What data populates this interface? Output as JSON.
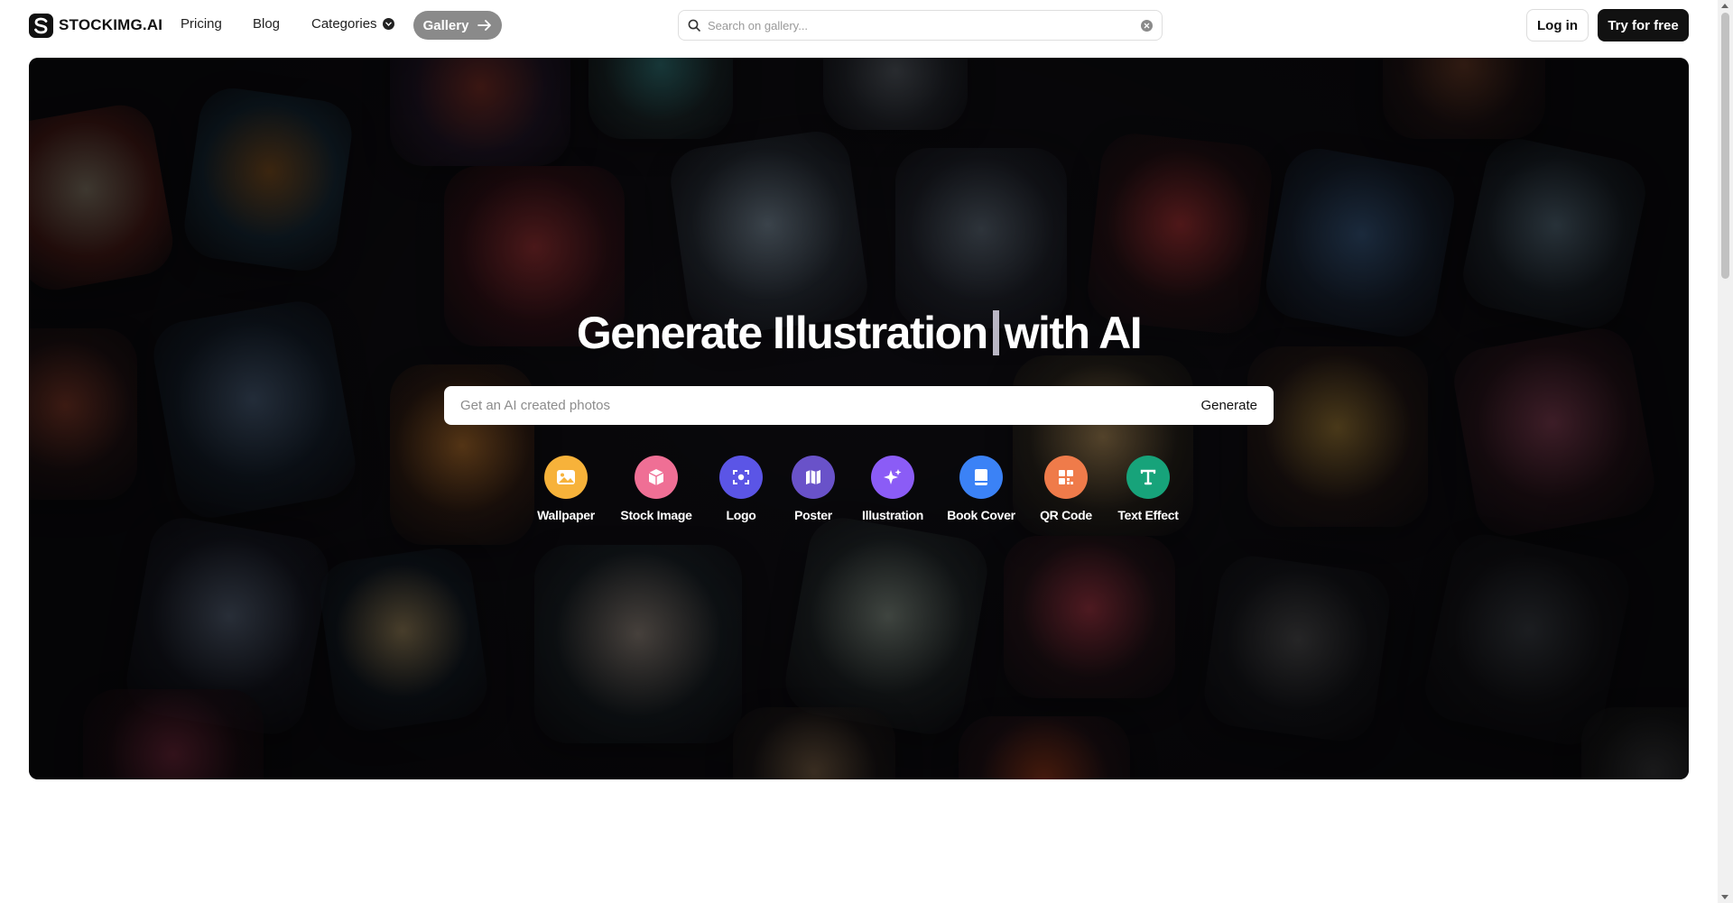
{
  "nav": {
    "logo_text": "STOCKIMG.AI",
    "links": {
      "pricing": "Pricing",
      "blog": "Blog",
      "categories": "Categories"
    },
    "gallery_label": "Gallery",
    "search_placeholder": "Search on gallery...",
    "login_label": "Log in",
    "try_label": "Try for free"
  },
  "hero": {
    "title_left": "Generate Illustration",
    "title_right": "with AI",
    "input_placeholder": "Get an AI created photos",
    "generate_label": "Generate",
    "categories": [
      {
        "label": "Wallpaper",
        "icon": "image-icon",
        "color": "#f7b23a"
      },
      {
        "label": "Stock Image",
        "icon": "cube-icon",
        "color": "#ef6f95"
      },
      {
        "label": "Logo",
        "icon": "focus-icon",
        "color": "#5b55e6"
      },
      {
        "label": "Poster",
        "icon": "map-icon",
        "color": "#6952c9"
      },
      {
        "label": "Illustration",
        "icon": "sparkle-icon",
        "color": "#8b5cf6"
      },
      {
        "label": "Book Cover",
        "icon": "book-icon",
        "color": "#3b82f6"
      },
      {
        "label": "QR Code",
        "icon": "qr-icon",
        "color": "#ef7b4a"
      },
      {
        "label": "Text Effect",
        "icon": "text-icon",
        "color": "#17a37a"
      }
    ]
  }
}
